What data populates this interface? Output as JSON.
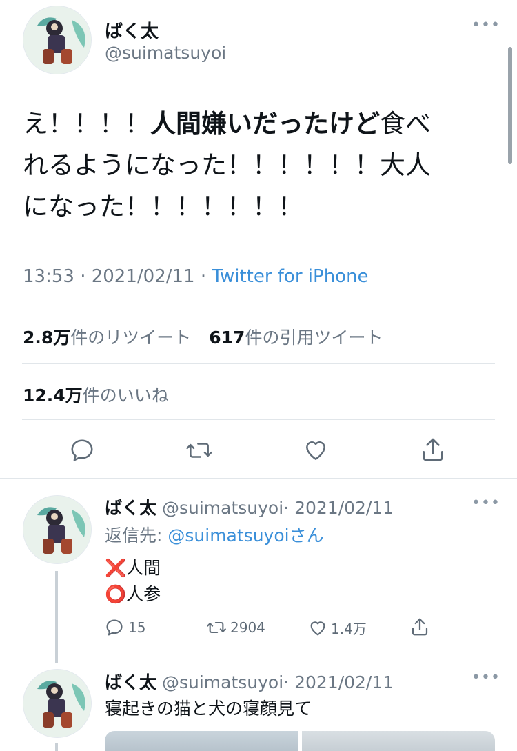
{
  "main_tweet": {
    "author_name": "ばく太",
    "handle": "@suimatsuyoi",
    "text_line1_pre": "え！！！！",
    "text_line1_bold": "人間嫌いだったけど",
    "text_line1_post": "食べ",
    "text_line2": "れるようになった！！！！！！大人",
    "text_line3": "になった！！！！！！！",
    "time": "13:53 · 2021/02/11 · ",
    "source": "Twitter for iPhone",
    "retweets_count": "2.8万",
    "retweets_label": "件のリツイート",
    "quotes_count": "617",
    "quotes_label": "件の引用ツイート",
    "likes_count": "12.4万",
    "likes_label": "件のいいね"
  },
  "reply1": {
    "author_name": "ばく太",
    "handle": "@suimatsuyoi",
    "date": "· 2021/02/11",
    "reply_to_label": "返信先: ",
    "reply_to_handle": "@suimatsuyoiさん",
    "line1_emoji": "❌",
    "line1_text": "人間",
    "line2_emoji": "⭕",
    "line2_text": "人参",
    "replies": "15",
    "retweets": "2904",
    "likes": "1.4万"
  },
  "reply2": {
    "author_name": "ばく太",
    "handle": "@suimatsuyoi",
    "date": "· 2021/02/11",
    "text": "寝起きの猫と犬の寝顔見て"
  },
  "more_label": "•••",
  "colors": {
    "link": "#3a8fd9",
    "muted": "#6b7784",
    "divider": "#e1e6ea",
    "red_x": "#e0245e"
  }
}
